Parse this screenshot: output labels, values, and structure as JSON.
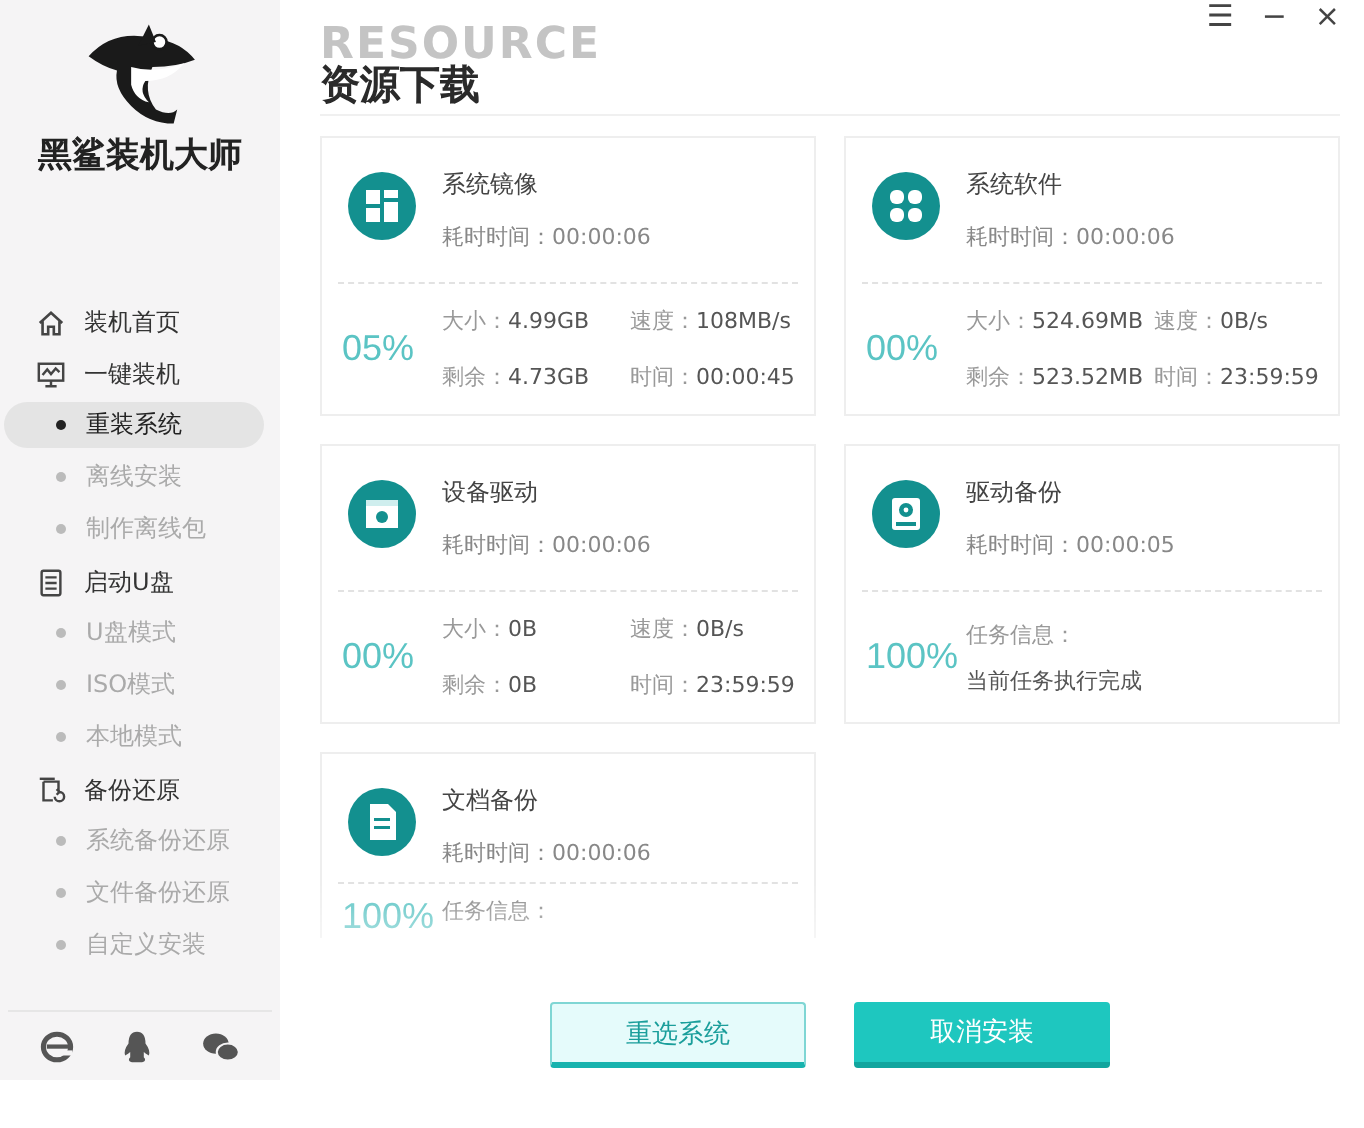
{
  "app": {
    "name": "黑鲨装机大师"
  },
  "sidebar": {
    "items": [
      {
        "kind": "section",
        "label": "装机首页",
        "selected": false
      },
      {
        "kind": "section",
        "label": "一键装机",
        "selected": false
      },
      {
        "kind": "sub",
        "label": "重装系统",
        "selected": true
      },
      {
        "kind": "sub",
        "label": "离线安装",
        "selected": false
      },
      {
        "kind": "sub",
        "label": "制作离线包",
        "selected": false
      },
      {
        "kind": "section",
        "label": "启动U盘",
        "selected": false
      },
      {
        "kind": "sub",
        "label": "U盘模式",
        "selected": false
      },
      {
        "kind": "sub",
        "label": "ISO模式",
        "selected": false
      },
      {
        "kind": "sub",
        "label": "本地模式",
        "selected": false
      },
      {
        "kind": "section",
        "label": "备份还原",
        "selected": false
      },
      {
        "kind": "sub",
        "label": "系统备份还原",
        "selected": false
      },
      {
        "kind": "sub",
        "label": "文件备份还原",
        "selected": false
      },
      {
        "kind": "sub",
        "label": "自定义安装",
        "selected": false
      }
    ]
  },
  "window_controls": [
    "☰",
    "−",
    "×"
  ],
  "page": {
    "background_word": "RESOURCE",
    "title": "资源下载"
  },
  "cards": [
    {
      "kind": "transfer",
      "title": "系统镜像",
      "elapsed": "耗时时间：00:00:06",
      "percent": "05%",
      "stats": [
        {
          "label": "大小：",
          "value": "4.99GB"
        },
        {
          "label": "速度：",
          "value": "108MB/s"
        },
        {
          "label": "剩余：",
          "value": "4.73GB"
        },
        {
          "label": "时间：",
          "value": "00:00:45"
        }
      ],
      "faded": false
    },
    {
      "kind": "transfer",
      "title": "系统软件",
      "elapsed": "耗时时间：00:00:06",
      "percent": "00%",
      "stats": [
        {
          "label": "大小：",
          "value": "524.69MB"
        },
        {
          "label": "速度：",
          "value": "0B/s"
        },
        {
          "label": "剩余：",
          "value": "523.52MB"
        },
        {
          "label": "时间：",
          "value": "23:59:59"
        }
      ],
      "faded": false
    },
    {
      "kind": "transfer",
      "title": "设备驱动",
      "elapsed": "耗时时间：00:00:06",
      "percent": "00%",
      "stats": [
        {
          "label": "大小：",
          "value": "0B"
        },
        {
          "label": "速度：",
          "value": "0B/s"
        },
        {
          "label": "剩余：",
          "value": "0B"
        },
        {
          "label": "时间：",
          "value": "23:59:59"
        }
      ],
      "faded": false
    },
    {
      "kind": "task",
      "title": "驱动备份",
      "elapsed": "耗时时间：00:00:05",
      "percent": "100%",
      "info_label": "任务信息：",
      "info": "当前任务执行完成",
      "faded": false
    },
    {
      "kind": "task",
      "title": "文档备份",
      "elapsed": "耗时时间：00:00:06",
      "percent": "100%",
      "info_label": "任务信息：",
      "faded": true
    }
  ],
  "buttons": [
    {
      "label": "重选系统",
      "kind": "secondary"
    },
    {
      "label": "取消安装",
      "kind": "primary"
    }
  ]
}
